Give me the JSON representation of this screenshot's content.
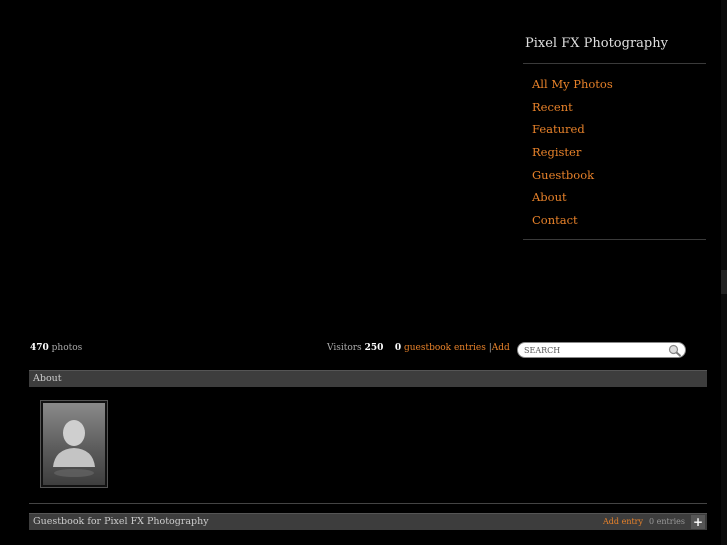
{
  "site": {
    "title": "Pixel FX Photography"
  },
  "nav": {
    "items": [
      "All My Photos",
      "Recent",
      "Featured",
      "Register",
      "Guestbook",
      "About",
      "Contact"
    ]
  },
  "stats": {
    "photo_count": "470",
    "photos_label": "photos",
    "visitors_label": "Visitors",
    "visitors_count": "250",
    "guestbook_count": "0",
    "guestbook_label": "guestbook entries",
    "separator": "|",
    "add_label": "Add"
  },
  "search": {
    "placeholder": "SEARCH"
  },
  "about": {
    "heading": "About"
  },
  "guestbook": {
    "heading": "Guestbook for Pixel FX Photography",
    "add_entry": "Add entry",
    "entries": "0 entries"
  },
  "colors": {
    "accent": "#e8822a",
    "bar": "#3d3d3d",
    "background": "#000000"
  }
}
